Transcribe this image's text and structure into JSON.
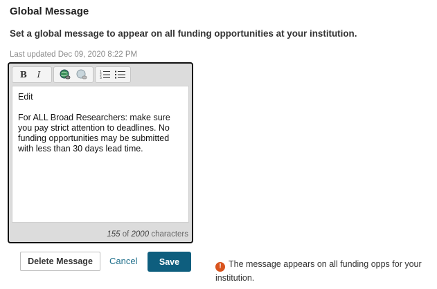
{
  "header": {
    "title": "Global Message",
    "subtitle": "Set a global message to appear on all funding opportunities at your institution.",
    "last_updated": "Last updated  Dec 09, 2020 8:22 PM"
  },
  "editor": {
    "toolbar": {
      "bold": "B",
      "italic": "I",
      "icons": [
        "bold-icon",
        "italic-icon",
        "link-icon",
        "unlink-icon",
        "numbered-list-icon",
        "bulleted-list-icon"
      ]
    },
    "paragraph_1": "Edit",
    "paragraph_2": "For ALL Broad Researchers: make sure you pay strict attention to deadlines.  No funding opportunities may be submitted with less than 30 days lead time.",
    "counter": {
      "count": "155",
      "of": "of",
      "max": "2000",
      "unit": "characters"
    }
  },
  "actions": {
    "delete_label": "Delete Message",
    "cancel_label": "Cancel",
    "save_label": "Save"
  },
  "notice": {
    "icon": "!",
    "text": "The message appears on all funding opps for your institution."
  },
  "colors": {
    "save_bg": "#0e5e7e",
    "link": "#1f6f8b",
    "warning": "#d9541e"
  }
}
